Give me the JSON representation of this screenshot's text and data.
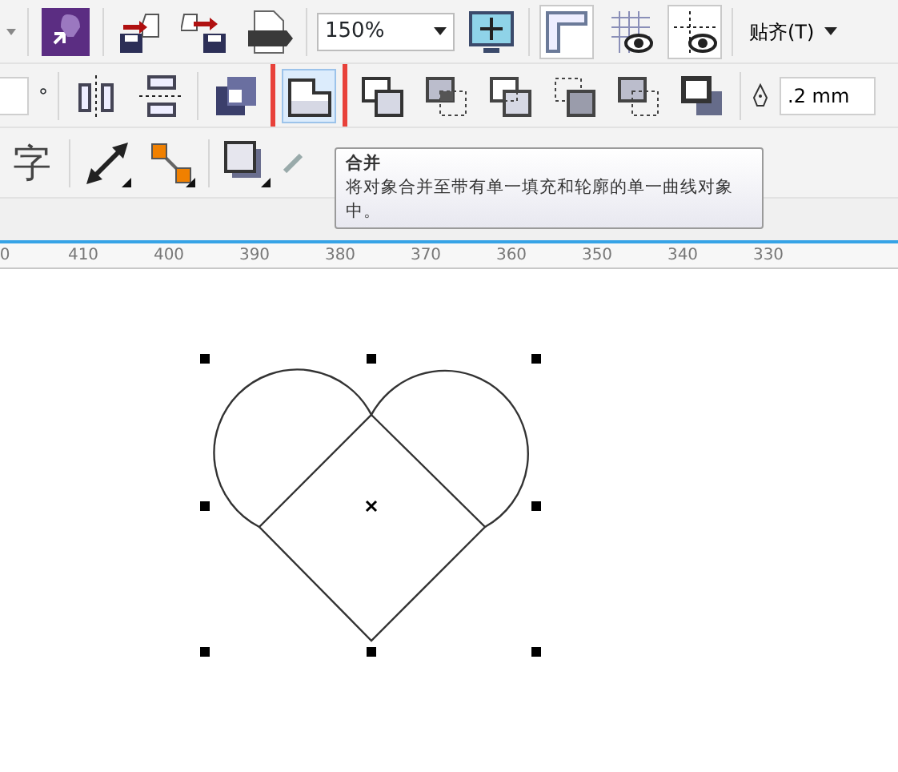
{
  "toolbar_top": {
    "zoom": "150%",
    "snap_menu": "贴齐(T)",
    "view_toggles": [
      {
        "kind": "rulers",
        "selected": true
      },
      {
        "kind": "grid",
        "selected": false
      },
      {
        "kind": "guides",
        "selected": true
      }
    ]
  },
  "property_bar": {
    "angle_unit": "°",
    "outline_width": ".2 mm",
    "shaping_buttons": [
      {
        "kind": "weld",
        "selected": true
      },
      {
        "kind": "trim",
        "selected": false
      },
      {
        "kind": "intersect",
        "selected": false
      },
      {
        "kind": "simplify",
        "selected": false
      },
      {
        "kind": "front_minus_back",
        "selected": false
      },
      {
        "kind": "back_minus_front",
        "selected": false
      },
      {
        "kind": "boundary",
        "selected": false
      }
    ]
  },
  "toolbox": {
    "text_tool": "字"
  },
  "tooltip": {
    "title": "合并",
    "text": "将对象合并至带有单一填充和轮廓的单一曲线对象中。"
  },
  "ruler": {
    "labels": [
      "0",
      "410",
      "400",
      "390",
      "380",
      "370",
      "360",
      "350",
      "340",
      "330"
    ]
  }
}
